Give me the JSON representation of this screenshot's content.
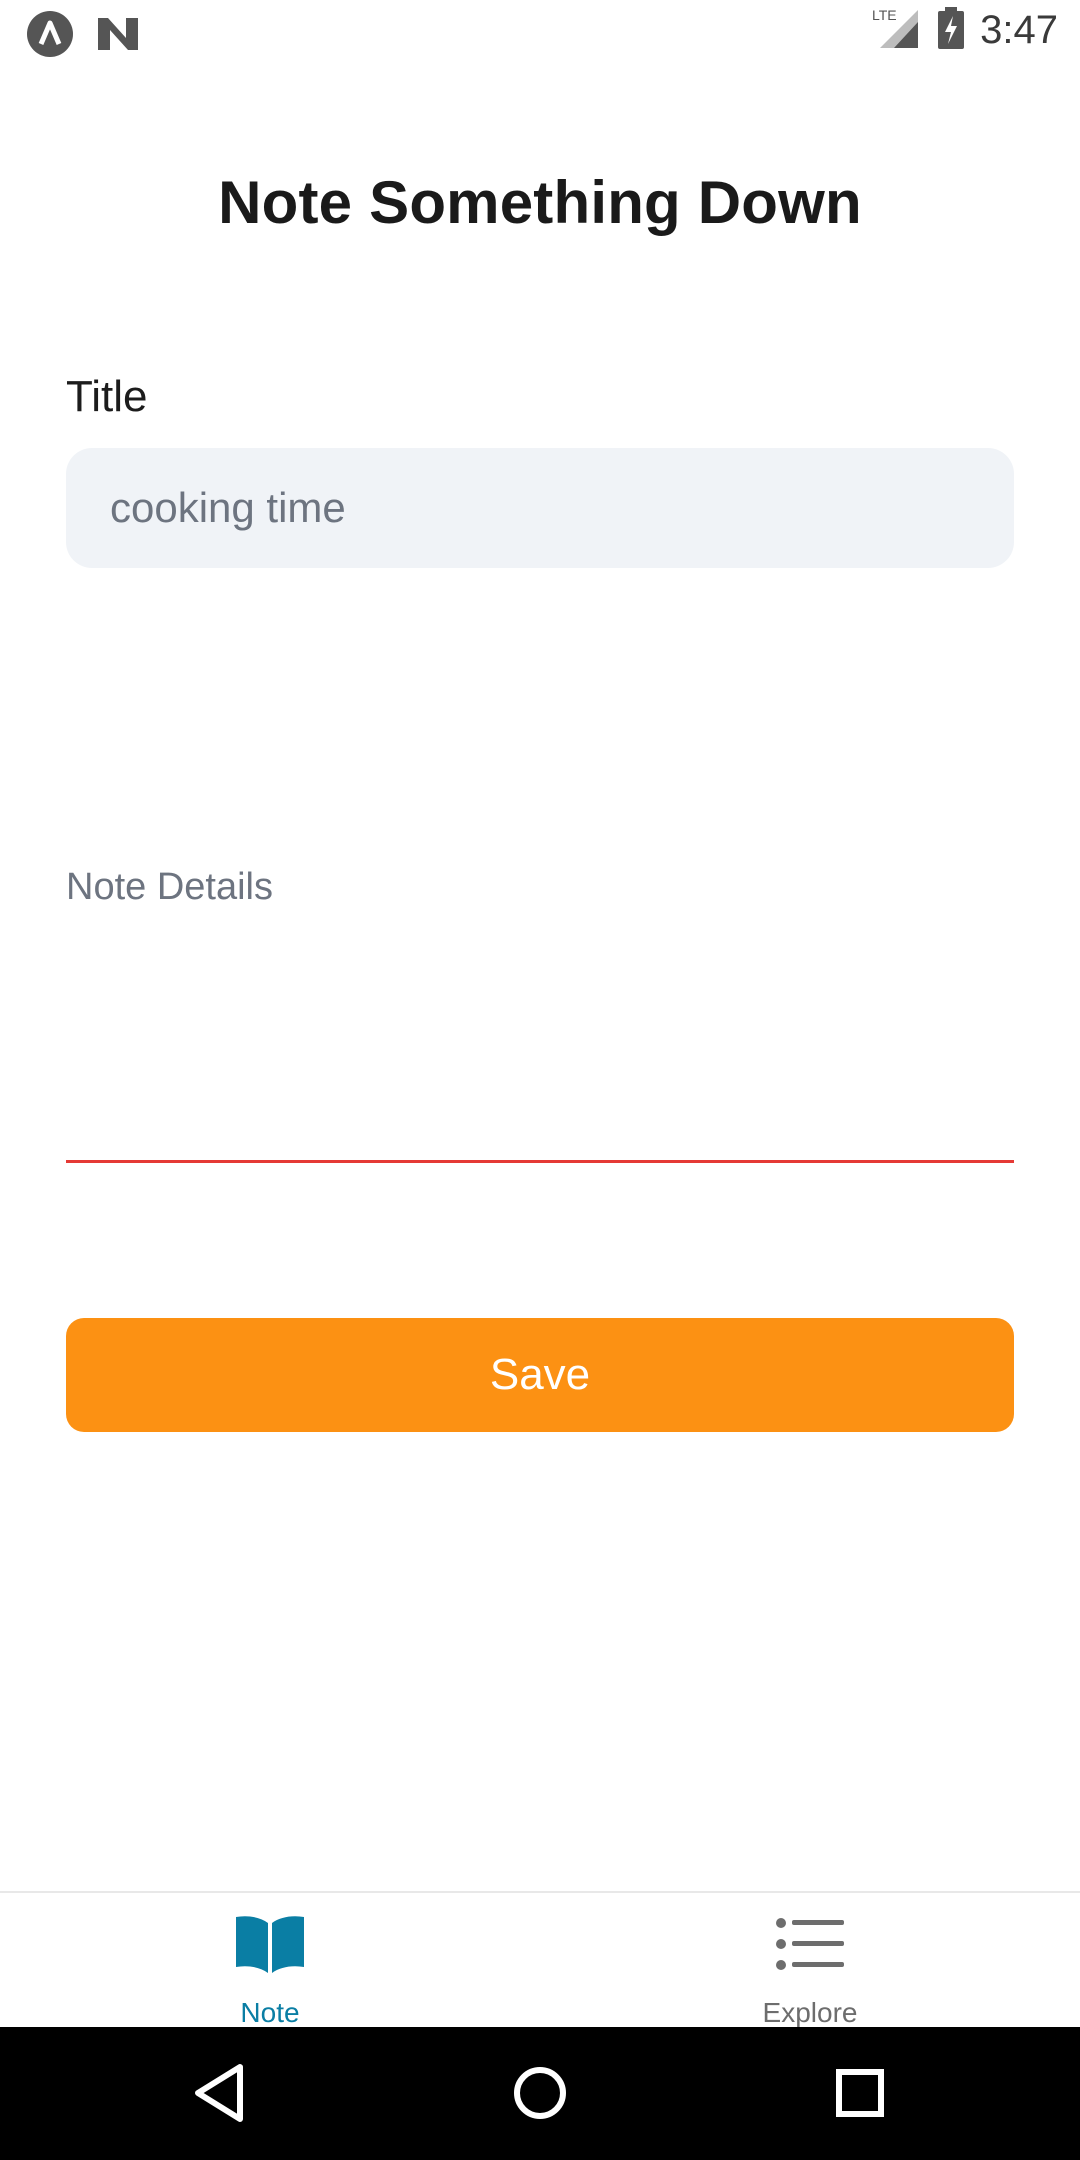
{
  "status_bar": {
    "time": "3:47",
    "network": "LTE",
    "left_icons": [
      "app-icon-a",
      "app-icon-n"
    ],
    "right_icons": [
      "signal-icon",
      "battery-charging-icon"
    ]
  },
  "page": {
    "title": "Note Something Down"
  },
  "form": {
    "title_label": "Title",
    "title_value": "cooking time",
    "details_label": "Note Details",
    "details_value": "",
    "save_label": "Save"
  },
  "tabs": [
    {
      "label": "Note",
      "icon": "open-book-icon",
      "active": true
    },
    {
      "label": "Explore",
      "icon": "list-icon",
      "active": false
    }
  ],
  "colors": {
    "accent": "#fc9113",
    "active_tab": "#0a7ea4",
    "inactive_tab": "#6d6d6d",
    "error_underline": "#e53935",
    "input_bg": "#f0f3f7"
  },
  "nav_bar": {
    "buttons": [
      "back-icon",
      "home-icon",
      "recents-icon"
    ]
  }
}
